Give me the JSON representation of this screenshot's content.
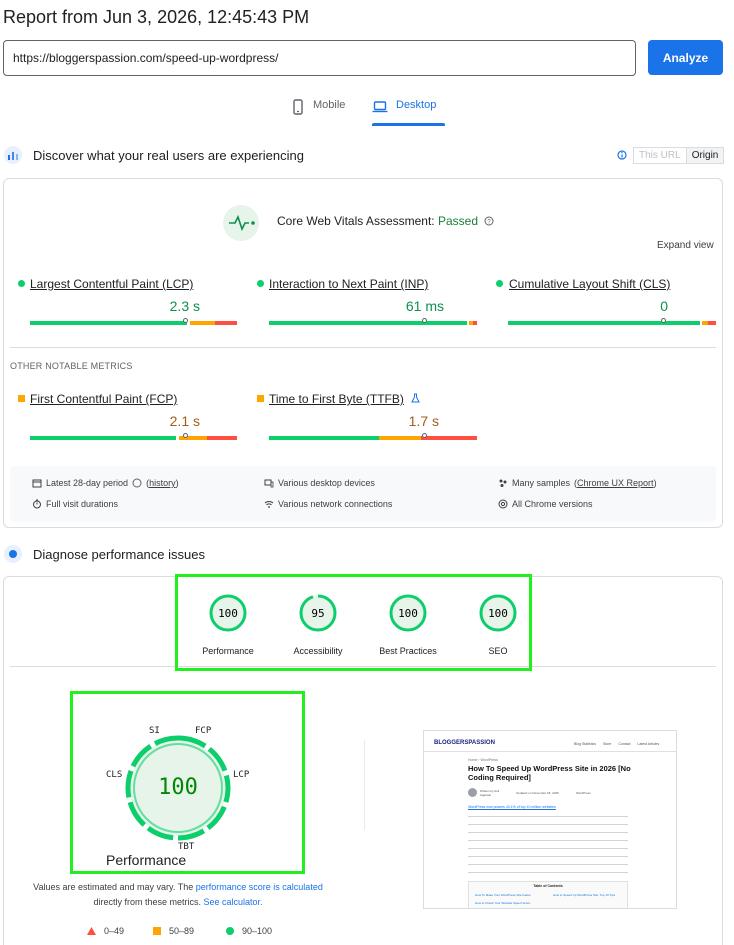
{
  "header": {
    "report_title": "Report from Jun 3, 2026, 12:45:43 PM",
    "url_value": "https://bloggerspassion.com/speed-up-wordpress/",
    "analyze_label": "Analyze"
  },
  "tabs": {
    "mobile": "Mobile",
    "desktop": "Desktop",
    "active": "Desktop"
  },
  "field_data": {
    "section_title": "Discover what your real users are experiencing",
    "toggle": {
      "this_url": "This URL",
      "origin": "Origin",
      "selected": "Origin"
    },
    "assessment_prefix": "Core Web Vitals Assessment:",
    "assessment_result": "Passed",
    "expand_label": "Expand view",
    "core_metrics": [
      {
        "label": "Largest Contentful Paint (LCP)",
        "value": "2.3 s",
        "status": "good"
      },
      {
        "label": "Interaction to Next Paint (INP)",
        "value": "61 ms",
        "status": "good"
      },
      {
        "label": "Cumulative Layout Shift (CLS)",
        "value": "0",
        "status": "good"
      }
    ],
    "other_label": "OTHER NOTABLE METRICS",
    "other_metrics": [
      {
        "label": "First Contentful Paint (FCP)",
        "value": "2.1 s",
        "status": "average"
      },
      {
        "label": "Time to First Byte (TTFB)",
        "value": "1.7 s",
        "status": "average"
      }
    ],
    "info": {
      "period_prefix": "Latest 28-day period",
      "period_link": "history",
      "devices": "Various desktop devices",
      "samples_prefix": "Many samples",
      "samples_link": "Chrome UX Report",
      "durations": "Full visit durations",
      "connections": "Various network connections",
      "versions": "All Chrome versions"
    }
  },
  "diagnose": {
    "section_title": "Diagnose performance issues",
    "scores": [
      {
        "label": "Performance",
        "value": "100"
      },
      {
        "label": "Accessibility",
        "value": "95"
      },
      {
        "label": "Best Practices",
        "value": "100"
      },
      {
        "label": "SEO",
        "value": "100"
      }
    ],
    "big_gauge": {
      "value": "100",
      "title": "Performance",
      "labels": {
        "si": "SI",
        "fcp": "FCP",
        "lcp": "LCP",
        "tbt": "TBT",
        "cls": "CLS"
      }
    },
    "note_prefix": "Values are estimated and may vary. The",
    "note_link1": "performance score is calculated",
    "note_middle": "directly from these metrics.",
    "note_link2": "See calculator.",
    "legend": [
      {
        "range": "0–49",
        "color": "#ff4e42"
      },
      {
        "range": "50–89",
        "color": "#ffa400"
      },
      {
        "range": "90–100",
        "color": "#0cce6b"
      }
    ]
  },
  "screenshot": {
    "logo": "BLOGGERSPASSION",
    "nav": [
      "Blog Statistics",
      "Store",
      "Contact",
      "Latest Articles"
    ],
    "breadcrumb": "Home › WordPress",
    "heading": "How To Speed Up WordPress Site in 2026 [No Coding Required]",
    "byline": "Written by Anil Agarwal",
    "updated": "Updated on November 18, 2025",
    "category": "WordPress",
    "para1_link": "WordPress now powers 43.1% of top 10 million websites",
    "toc_title": "Table of Contents",
    "toc_items": [
      "How To Make Your WordPress Site Faster",
      "How to Speed Up WordPress Site: Top 10 Tips",
      "How to Check Your Website Speed Score"
    ]
  },
  "colors": {
    "good": "#0cce6b",
    "average": "#ffa400",
    "poor": "#ff4e42",
    "accent": "#1a73e8",
    "highlight": "#22f01e"
  }
}
